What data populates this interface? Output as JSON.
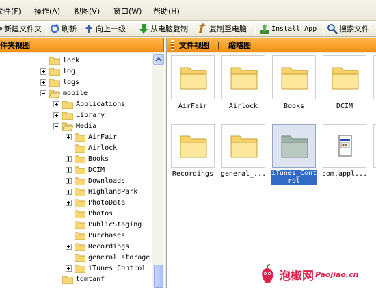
{
  "menu": {
    "items": [
      {
        "label": "文件(F)"
      },
      {
        "label": "操作(A)"
      },
      {
        "label": "视图(V)"
      },
      {
        "label": "窗口(W)"
      },
      {
        "label": "帮助(H)"
      }
    ]
  },
  "toolbar": {
    "new_folder": "新建文件夹",
    "refresh": "刷新",
    "up_level": "向上一级",
    "copy_from_pc": "从电脑复制",
    "copy_to_pc": "复制至电脑",
    "install_app": "Install App",
    "search_file": "搜索文件"
  },
  "left_panel": {
    "title": "件夹视图"
  },
  "right_panel": {
    "tab_files": "文件视图",
    "divider": "|",
    "tab_thumbs": "缩略图"
  },
  "tree": {
    "nodes": [
      {
        "label": "lock"
      },
      {
        "label": "log"
      },
      {
        "label": "logs"
      },
      {
        "label": "mobile"
      },
      {
        "label": "Applications"
      },
      {
        "label": "Library"
      },
      {
        "label": "Media"
      },
      {
        "label": "AirFair"
      },
      {
        "label": "Airlock"
      },
      {
        "label": "Books"
      },
      {
        "label": "DCIM"
      },
      {
        "label": "Downloads"
      },
      {
        "label": "HighlandPark"
      },
      {
        "label": "PhotoData"
      },
      {
        "label": "Photos"
      },
      {
        "label": "PublicStaging"
      },
      {
        "label": "Purchases"
      },
      {
        "label": "Recordings"
      },
      {
        "label": "general_storage"
      },
      {
        "label": "iTunes_Control"
      },
      {
        "label": "tdmtanf"
      }
    ]
  },
  "icons": {
    "items": [
      {
        "label": "AirFair"
      },
      {
        "label": "Airlock"
      },
      {
        "label": "Books"
      },
      {
        "label": "DCIM"
      },
      {
        "label": "Recordings"
      },
      {
        "label": "general_..."
      },
      {
        "label": "iTunes_Control"
      },
      {
        "label": "com.appl..."
      }
    ]
  },
  "colors": {
    "header_orange": "#f7a53a",
    "selection_blue": "#316ac5",
    "watermark_red": "#e0204a"
  }
}
